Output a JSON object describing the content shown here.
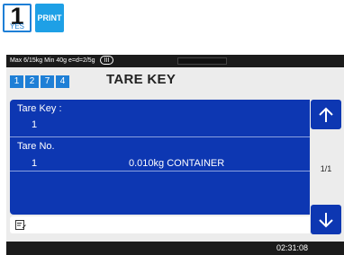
{
  "keys": {
    "yes_number": "1",
    "yes_label": "YES",
    "print_label": "PRINT"
  },
  "status_bar": {
    "text": "Max 6/15kg Min 40g e=d=2/5g",
    "mode": "III"
  },
  "breadcrumb": [
    "1",
    "2",
    "7",
    "4"
  ],
  "title": "TARE KEY",
  "tare_key": {
    "label": "Tare Key :",
    "value": "1"
  },
  "tare_no": {
    "label": "Tare No.",
    "rows": [
      {
        "number": "1",
        "description": "0.010kg CONTAINER"
      }
    ]
  },
  "input": {
    "icon": "edit-note-icon",
    "value": ""
  },
  "nav": {
    "up_icon": "arrow-up-icon",
    "down_icon": "arrow-down-icon",
    "page": "1/1"
  },
  "footer": {
    "time": "02:31:08"
  },
  "colors": {
    "accent": "#1e7fd6",
    "panel": "#0d37b2",
    "bar": "#1b1b1b",
    "background": "#ececec"
  }
}
